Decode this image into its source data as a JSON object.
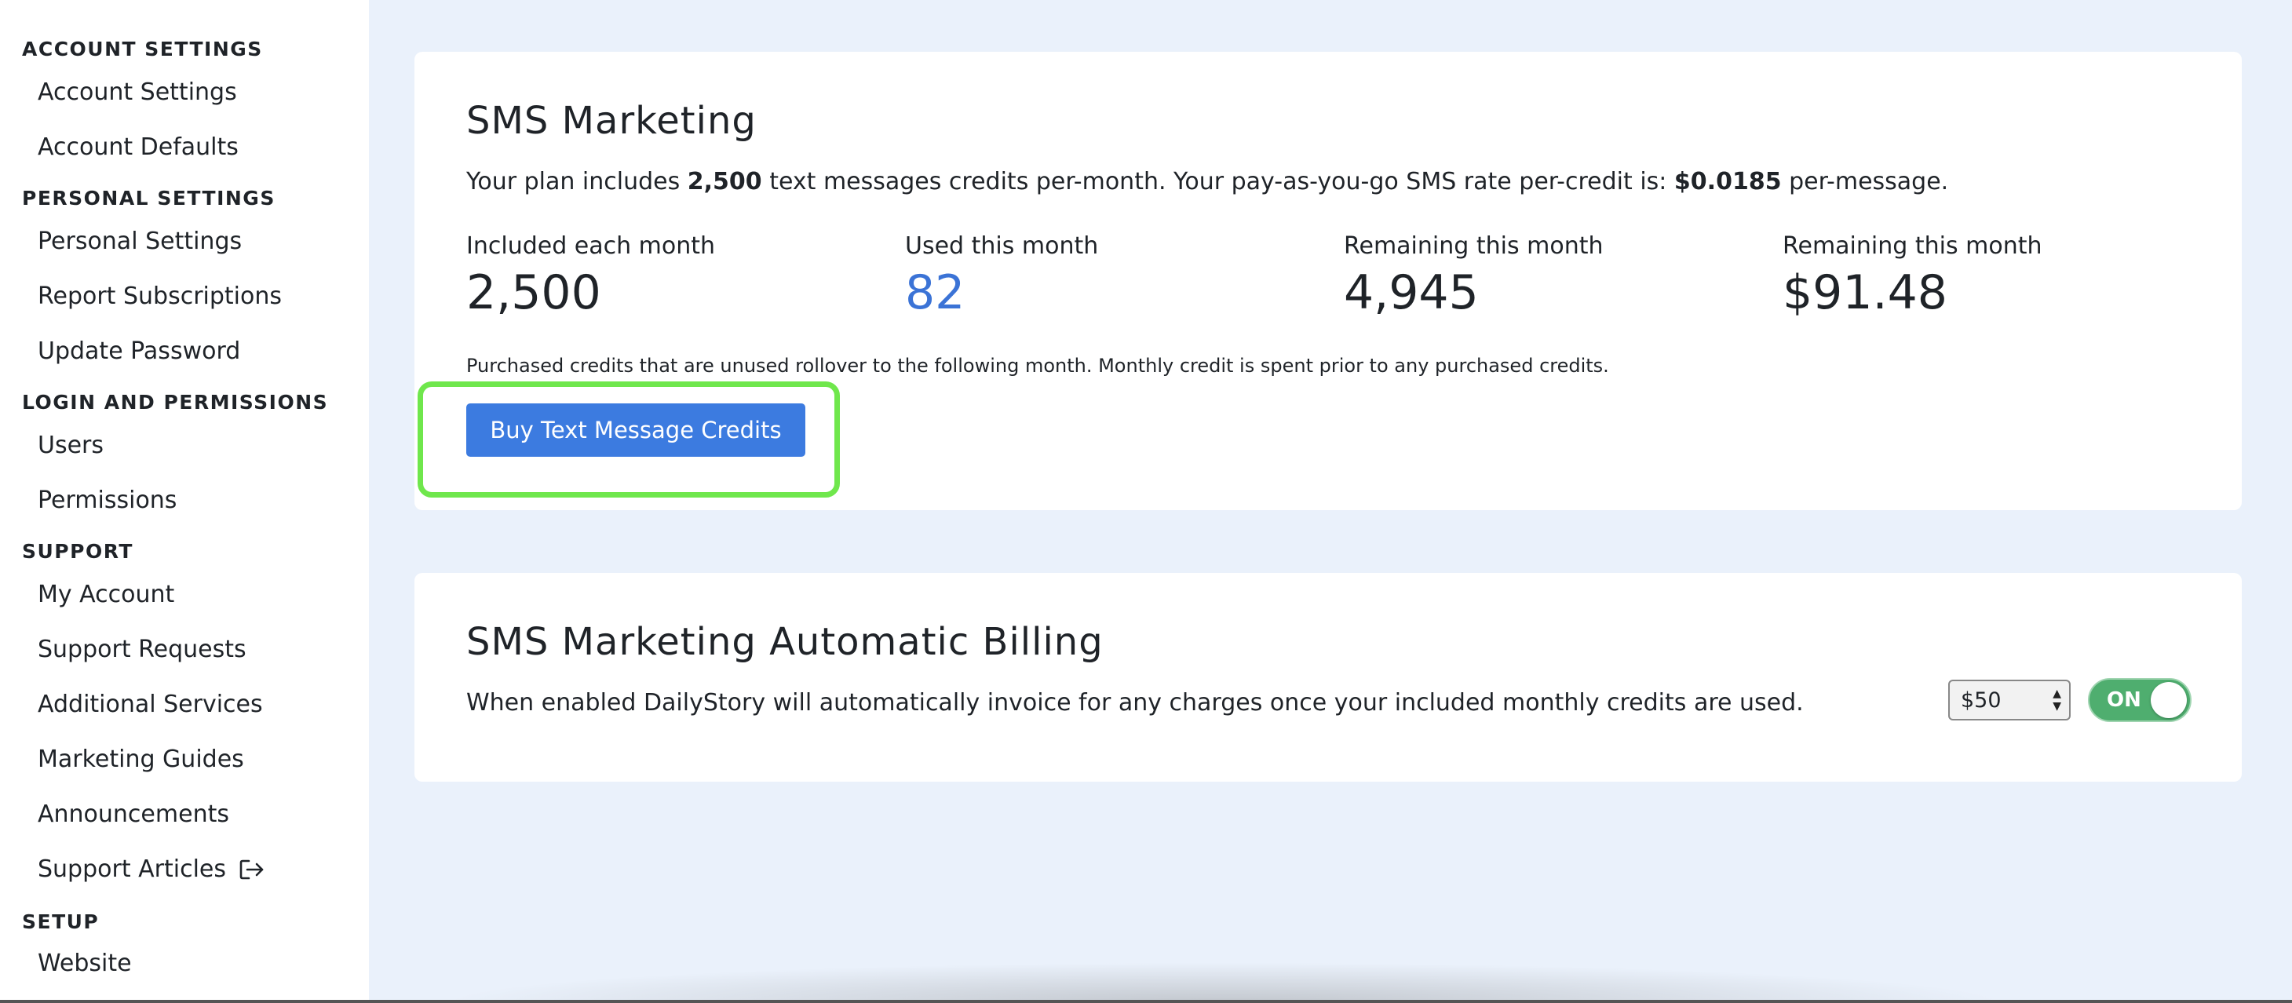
{
  "sidebar": {
    "sections": [
      {
        "title": "ACCOUNT SETTINGS",
        "items": [
          "Account Settings",
          "Account Defaults"
        ]
      },
      {
        "title": "PERSONAL SETTINGS",
        "items": [
          "Personal Settings",
          "Report Subscriptions",
          "Update Password"
        ]
      },
      {
        "title": "LOGIN AND PERMISSIONS",
        "items": [
          "Users",
          "Permissions"
        ]
      },
      {
        "title": "SUPPORT",
        "items": [
          "My Account",
          "Support Requests",
          "Additional Services",
          "Marketing Guides",
          "Announcements",
          "Support Articles"
        ]
      },
      {
        "title": "SETUP",
        "items": [
          "Website"
        ]
      }
    ]
  },
  "sms_marketing": {
    "title": "SMS Marketing",
    "desc_pre": "Your plan includes ",
    "desc_credits": "2,500",
    "desc_mid": " text messages credits per-month. Your pay-as-you-go SMS rate per-credit is: ",
    "desc_rate": "$0.0185",
    "desc_post": " per-message.",
    "stats": [
      {
        "label": "Included each month",
        "value": "2,500"
      },
      {
        "label": "Used this month",
        "value": "82"
      },
      {
        "label": "Remaining this month",
        "value": "4,945"
      },
      {
        "label": "Remaining this month",
        "value": "$91.48"
      }
    ],
    "note": "Purchased credits that are unused rollover to the following month. Monthly credit is spent prior to any purchased credits.",
    "buy_button": "Buy Text Message Credits"
  },
  "auto_billing": {
    "title": "SMS Marketing Automatic Billing",
    "desc": "When enabled DailyStory will automatically invoice for any charges once your included monthly credits are used.",
    "amount_selected": "$50",
    "toggle_label": "ON"
  },
  "colors": {
    "accent_blue": "#3c7be0",
    "used_value_blue": "#3b73d6",
    "highlight_green": "#6fe74c",
    "toggle_green": "#4fae6f"
  },
  "icons": {
    "support_articles": "external-link-icon"
  }
}
